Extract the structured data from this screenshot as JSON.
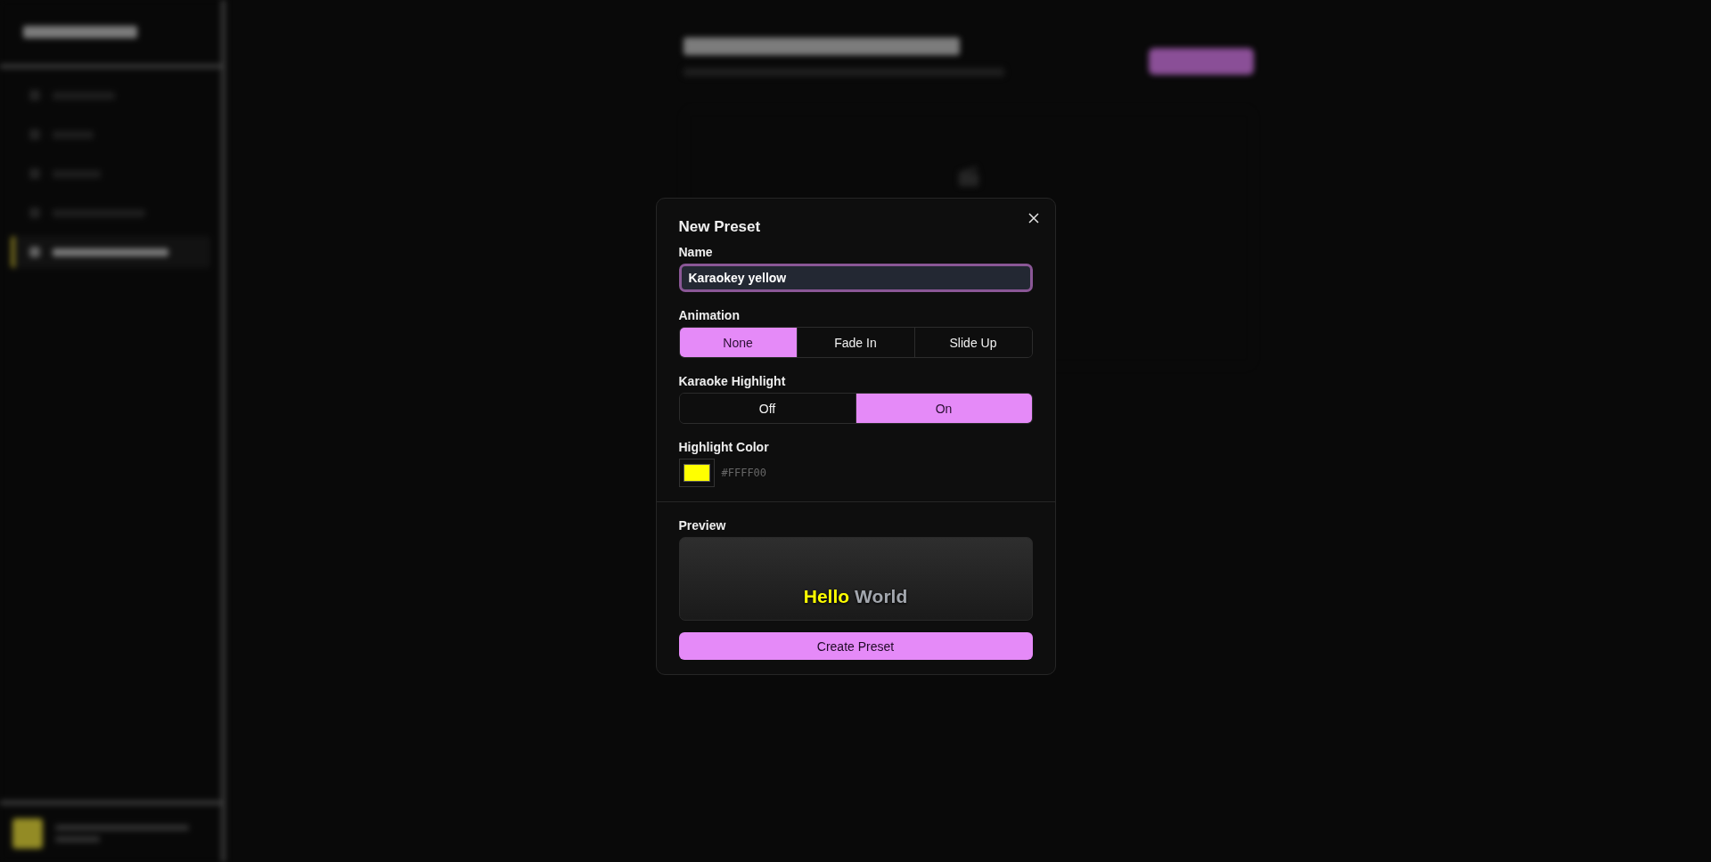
{
  "sidebar": {
    "items": [
      {
        "selected": false
      },
      {
        "selected": false
      },
      {
        "selected": false
      },
      {
        "selected": false
      },
      {
        "selected": true
      }
    ]
  },
  "dialog": {
    "title": "New Preset",
    "name_label": "Name",
    "name_value": "Karaokey yellow",
    "animation_label": "Animation",
    "animation_options": [
      {
        "label": "None",
        "selected": true
      },
      {
        "label": "Fade In",
        "selected": false
      },
      {
        "label": "Slide Up",
        "selected": false
      }
    ],
    "karaoke_label": "Karaoke Highlight",
    "karaoke_options": [
      {
        "label": "Off",
        "selected": false
      },
      {
        "label": "On",
        "selected": true
      }
    ],
    "color_label": "Highlight Color",
    "color": "#ffff00",
    "color_text": "#FFFF00",
    "preview_label": "Preview",
    "preview_words": [
      {
        "text": "Hello",
        "highlighted": true
      },
      {
        "text": "World",
        "highlighted": false
      }
    ],
    "submit": "Create Preset"
  }
}
